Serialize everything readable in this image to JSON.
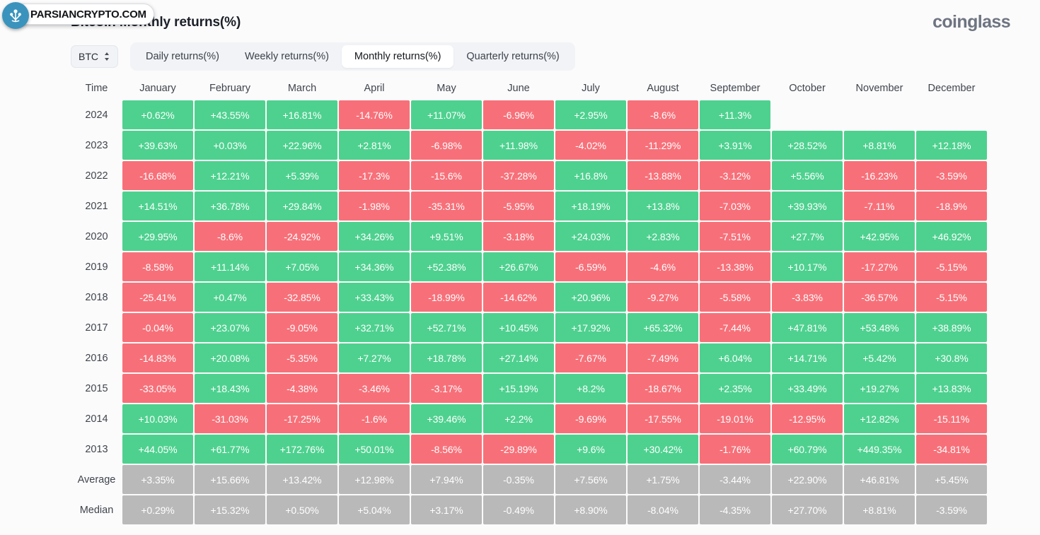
{
  "header": {
    "title": "Bitcoin Monthly returns(%)",
    "brand": "coinglass"
  },
  "watermark": {
    "text": "PARSIANCRYPTO.COM",
    "icon": "plant-logo-icon"
  },
  "controls": {
    "coin_selector": {
      "label": "BTC",
      "icon": "chevron-updown-icon"
    },
    "tabs": [
      {
        "label": "Daily returns(%)",
        "active": false
      },
      {
        "label": "Weekly returns(%)",
        "active": false
      },
      {
        "label": "Monthly returns(%)",
        "active": true
      },
      {
        "label": "Quarterly returns(%)",
        "active": false
      }
    ]
  },
  "colors": {
    "positive": "#4ed18f",
    "negative": "#f77079",
    "stat": "#b9b9b9",
    "background": "#fbfbfb",
    "text": "#3f444d"
  },
  "chart_data": {
    "type": "heatmap",
    "title": "Bitcoin Monthly returns(%)",
    "xlabel": "",
    "ylabel": "Time",
    "legend_position": "none",
    "grid": false,
    "columns": [
      "Time",
      "January",
      "February",
      "March",
      "April",
      "May",
      "June",
      "July",
      "August",
      "September",
      "October",
      "November",
      "December"
    ],
    "categories": [
      "January",
      "February",
      "March",
      "April",
      "May",
      "June",
      "July",
      "August",
      "September",
      "October",
      "November",
      "December"
    ],
    "rows": [
      {
        "label": "2024",
        "kind": "year",
        "values": [
          "+0.62%",
          "+43.55%",
          "+16.81%",
          "-14.76%",
          "+11.07%",
          "-6.96%",
          "+2.95%",
          "-8.6%",
          "+11.3%",
          "",
          "",
          ""
        ]
      },
      {
        "label": "2023",
        "kind": "year",
        "values": [
          "+39.63%",
          "+0.03%",
          "+22.96%",
          "+2.81%",
          "-6.98%",
          "+11.98%",
          "-4.02%",
          "-11.29%",
          "+3.91%",
          "+28.52%",
          "+8.81%",
          "+12.18%"
        ]
      },
      {
        "label": "2022",
        "kind": "year",
        "values": [
          "-16.68%",
          "+12.21%",
          "+5.39%",
          "-17.3%",
          "-15.6%",
          "-37.28%",
          "+16.8%",
          "-13.88%",
          "-3.12%",
          "+5.56%",
          "-16.23%",
          "-3.59%"
        ]
      },
      {
        "label": "2021",
        "kind": "year",
        "values": [
          "+14.51%",
          "+36.78%",
          "+29.84%",
          "-1.98%",
          "-35.31%",
          "-5.95%",
          "+18.19%",
          "+13.8%",
          "-7.03%",
          "+39.93%",
          "-7.11%",
          "-18.9%"
        ]
      },
      {
        "label": "2020",
        "kind": "year",
        "values": [
          "+29.95%",
          "-8.6%",
          "-24.92%",
          "+34.26%",
          "+9.51%",
          "-3.18%",
          "+24.03%",
          "+2.83%",
          "-7.51%",
          "+27.7%",
          "+42.95%",
          "+46.92%"
        ]
      },
      {
        "label": "2019",
        "kind": "year",
        "values": [
          "-8.58%",
          "+11.14%",
          "+7.05%",
          "+34.36%",
          "+52.38%",
          "+26.67%",
          "-6.59%",
          "-4.6%",
          "-13.38%",
          "+10.17%",
          "-17.27%",
          "-5.15%"
        ]
      },
      {
        "label": "2018",
        "kind": "year",
        "values": [
          "-25.41%",
          "+0.47%",
          "-32.85%",
          "+33.43%",
          "-18.99%",
          "-14.62%",
          "+20.96%",
          "-9.27%",
          "-5.58%",
          "-3.83%",
          "-36.57%",
          "-5.15%"
        ]
      },
      {
        "label": "2017",
        "kind": "year",
        "values": [
          "-0.04%",
          "+23.07%",
          "-9.05%",
          "+32.71%",
          "+52.71%",
          "+10.45%",
          "+17.92%",
          "+65.32%",
          "-7.44%",
          "+47.81%",
          "+53.48%",
          "+38.89%"
        ]
      },
      {
        "label": "2016",
        "kind": "year",
        "values": [
          "-14.83%",
          "+20.08%",
          "-5.35%",
          "+7.27%",
          "+18.78%",
          "+27.14%",
          "-7.67%",
          "-7.49%",
          "+6.04%",
          "+14.71%",
          "+5.42%",
          "+30.8%"
        ]
      },
      {
        "label": "2015",
        "kind": "year",
        "values": [
          "-33.05%",
          "+18.43%",
          "-4.38%",
          "-3.46%",
          "-3.17%",
          "+15.19%",
          "+8.2%",
          "-18.67%",
          "+2.35%",
          "+33.49%",
          "+19.27%",
          "+13.83%"
        ]
      },
      {
        "label": "2014",
        "kind": "year",
        "values": [
          "+10.03%",
          "-31.03%",
          "-17.25%",
          "-1.6%",
          "+39.46%",
          "+2.2%",
          "-9.69%",
          "-17.55%",
          "-19.01%",
          "-12.95%",
          "+12.82%",
          "-15.11%"
        ]
      },
      {
        "label": "2013",
        "kind": "year",
        "values": [
          "+44.05%",
          "+61.77%",
          "+172.76%",
          "+50.01%",
          "-8.56%",
          "-29.89%",
          "+9.6%",
          "+30.42%",
          "-1.76%",
          "+60.79%",
          "+449.35%",
          "-34.81%"
        ]
      },
      {
        "label": "Average",
        "kind": "stat",
        "values": [
          "+3.35%",
          "+15.66%",
          "+13.42%",
          "+12.98%",
          "+7.94%",
          "-0.35%",
          "+7.56%",
          "+1.75%",
          "-3.44%",
          "+22.90%",
          "+46.81%",
          "+5.45%"
        ]
      },
      {
        "label": "Median",
        "kind": "stat",
        "values": [
          "+0.29%",
          "+15.32%",
          "+0.50%",
          "+5.04%",
          "+3.17%",
          "-0.49%",
          "+8.90%",
          "-8.04%",
          "-4.35%",
          "+27.70%",
          "+8.81%",
          "-3.59%"
        ]
      }
    ]
  }
}
